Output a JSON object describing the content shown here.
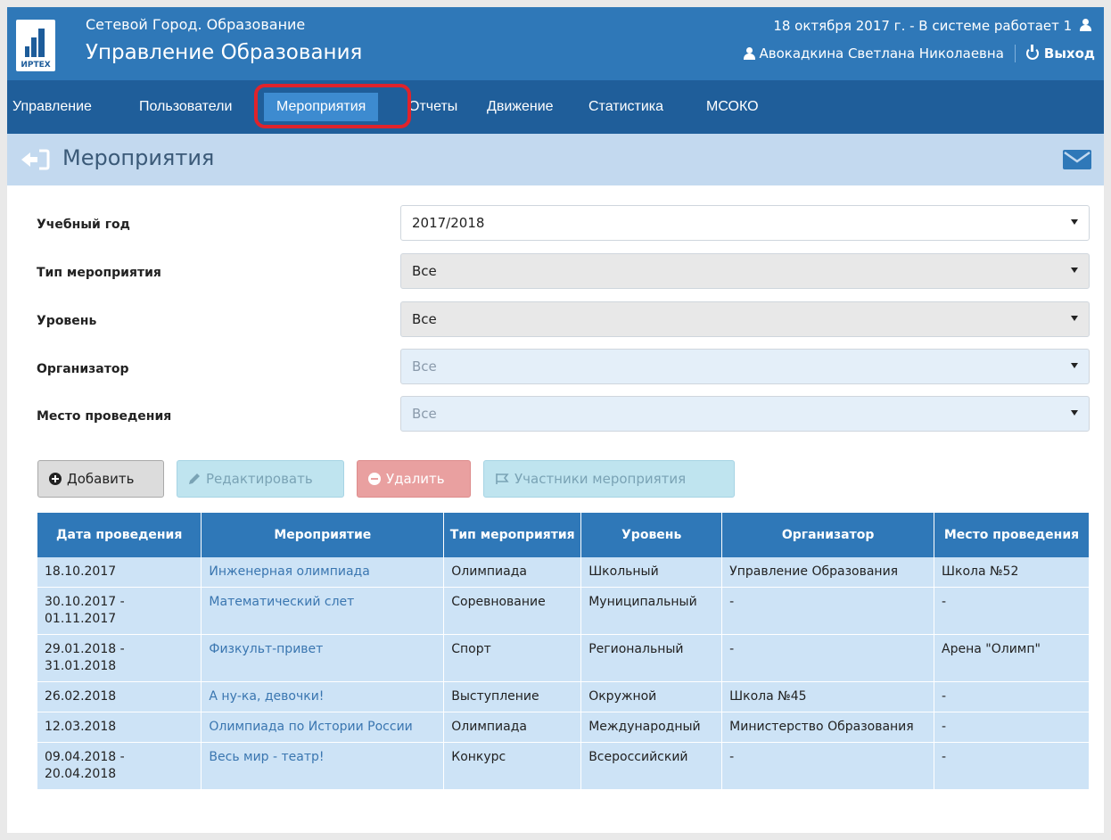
{
  "header": {
    "logo_text": "ИРТЕХ",
    "subtitle": "Сетевой Город. Образование",
    "title": "Управление Образования",
    "status": "18 октября 2017 г. - В системе работает 1",
    "user_name": "Авокадкина Светлана Николаевна",
    "logout_label": "Выход"
  },
  "nav": {
    "items": [
      "Управление",
      "Пользователи",
      "Мероприятия",
      "Отчеты",
      "Движение",
      "Статистика",
      "МСОКО"
    ],
    "active": "Мероприятия"
  },
  "page": {
    "title": "Мероприятия"
  },
  "filters": [
    {
      "label": "Учебный год",
      "value": "2017/2018"
    },
    {
      "label": "Тип мероприятия",
      "value": "Все"
    },
    {
      "label": "Уровень",
      "value": "Все"
    },
    {
      "label": "Организатор",
      "value": "Все"
    },
    {
      "label": "Место проведения",
      "value": "Все"
    }
  ],
  "toolbar": {
    "add_label": "Добавить",
    "edit_label": "Редактировать",
    "delete_label": "Удалить",
    "participants_label": "Участники мероприятия"
  },
  "table": {
    "headers": [
      "Дата проведения",
      "Мероприятие",
      "Тип мероприятия",
      "Уровень",
      "Организатор",
      "Место проведения"
    ],
    "rows": [
      [
        "18.10.2017",
        "Инженерная олимпиада",
        "Олимпиада",
        "Школьный",
        "Управление Образования",
        "Школа №52"
      ],
      [
        "30.10.2017 - 01.11.2017",
        "Математический слет",
        "Соревнование",
        "Муниципальный",
        "-",
        "-"
      ],
      [
        "29.01.2018 - 31.01.2018",
        "Физкульт-привет",
        "Спорт",
        "Региональный",
        "-",
        "Арена \"Олимп\""
      ],
      [
        "26.02.2018",
        "А ну-ка, девочки!",
        "Выступление",
        "Окружной",
        "Школа №45",
        "-"
      ],
      [
        "12.03.2018",
        "Олимпиада по Истории России",
        "Олимпиада",
        "Международный",
        "Министерство Образования",
        "-"
      ],
      [
        "09.04.2018 - 20.04.2018",
        "Весь мир - театр!",
        "Конкурс",
        "Всероссийский",
        "-",
        "-"
      ]
    ]
  },
  "colors": {
    "header_bg": "#2f78b8",
    "nav_bg": "#1f5e9a",
    "nav_active": "#3d8bd0",
    "highlight": "#e0232b",
    "table_row": "#cde3f6",
    "link": "#3a76b0"
  }
}
